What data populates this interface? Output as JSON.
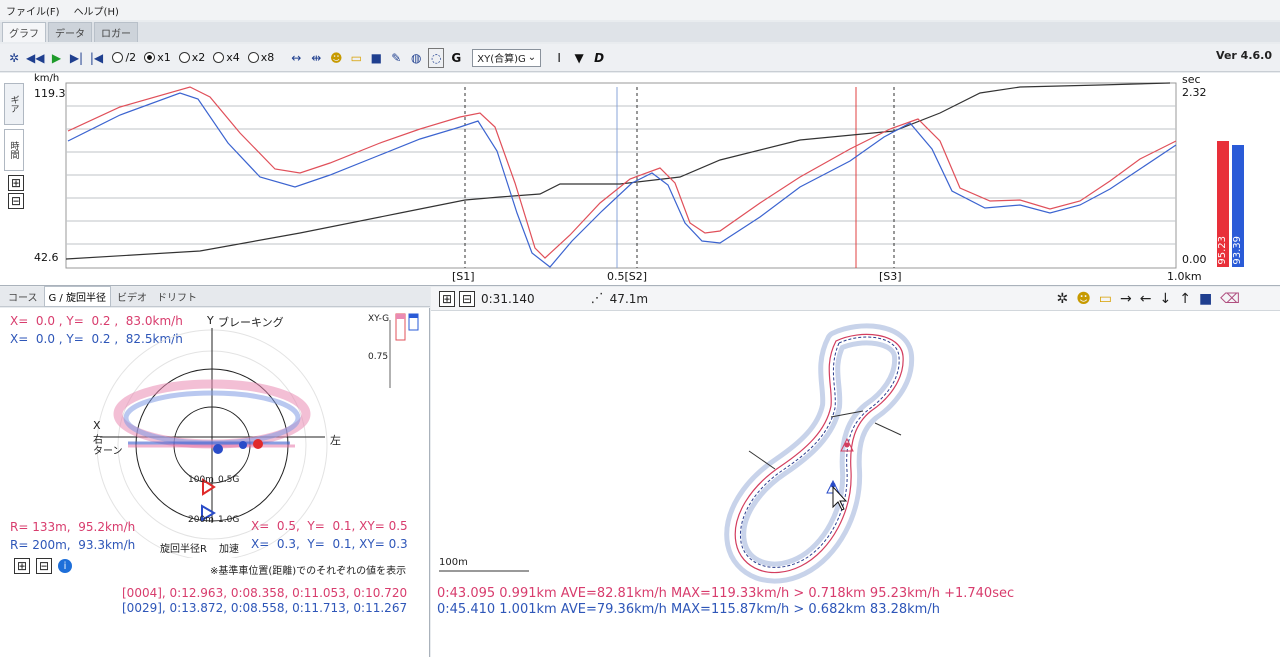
{
  "menu": {
    "file": "ファイル(F)",
    "help": "ヘルプ(H)"
  },
  "tabs": [
    "グラフ",
    "データ",
    "ロガー"
  ],
  "toolbar": {
    "speeds": [
      "/2",
      "x1",
      "x2",
      "x4",
      "x8"
    ],
    "selected_speed": "x1",
    "g_label": "G",
    "select_value": "XY(合算)G",
    "d_label": "D",
    "version": "Ver 4.6.0"
  },
  "graph": {
    "y_unit_left": "km/h",
    "y_max_left": "119.3",
    "y_min_left": "42.6",
    "y_unit_right": "sec",
    "y_max_right": "2.32",
    "y_min_right": "0.00",
    "side_tabs": [
      "ギア",
      "時間"
    ],
    "sectors": [
      "[S1]",
      "0.5[S2]",
      "[S3]",
      "1.0km"
    ],
    "bar_red_value": "95.23",
    "bar_blue_value": "93.39",
    "colors": {
      "red": "#e8303a",
      "blue": "#2a5bd7"
    }
  },
  "gpanel": {
    "tabs": [
      "コース",
      "G / 旋回半径",
      "ビデオ",
      "ドリフト"
    ],
    "red_xy": "X=  0.0 , Y=  0.2 ,  83.0km/h",
    "blue_xy": "X=  0.0 , Y=  0.2 ,  82.5km/h",
    "y_label": "Y",
    "braking": "ブレーキング",
    "x_label": "X",
    "right_turn": "右\nターン",
    "left": "左",
    "xyg": "XY-G",
    "scale": "0.75",
    "ring1": "100m",
    "ring1g": "0.5G",
    "ring2": "200m",
    "ring2g": "1.0G",
    "red_r": "R= 133m,  95.2km/h",
    "blue_r": "R= 200m,  93.3km/h",
    "red_g": "X=  0.5,  Y=  0.1, XY= 0.5",
    "blue_g": "X=  0.3,  Y=  0.1, XY= 0.3",
    "turn_radius": "旋回半径R",
    "accel": "加速",
    "note": "※基準車位置(距離)でのそれぞれの値を表示",
    "lap_red": "[0004], 0:12.963, 0:08.358, 0:11.053, 0:10.720",
    "lap_blue": "[0029], 0:13.872, 0:08.558, 0:11.713, 0:11.267"
  },
  "map": {
    "time": "0:31.140",
    "distance": "47.1m",
    "scale_label": "100m",
    "stats_red": "0:43.095 0.991km AVE=82.81km/h MAX=119.33km/h > 0.718km 95.23km/h +1.740sec",
    "stats_blue": "0:45.410 1.001km AVE=79.36km/h MAX=115.87km/h > 0.682km 83.28km/h"
  }
}
